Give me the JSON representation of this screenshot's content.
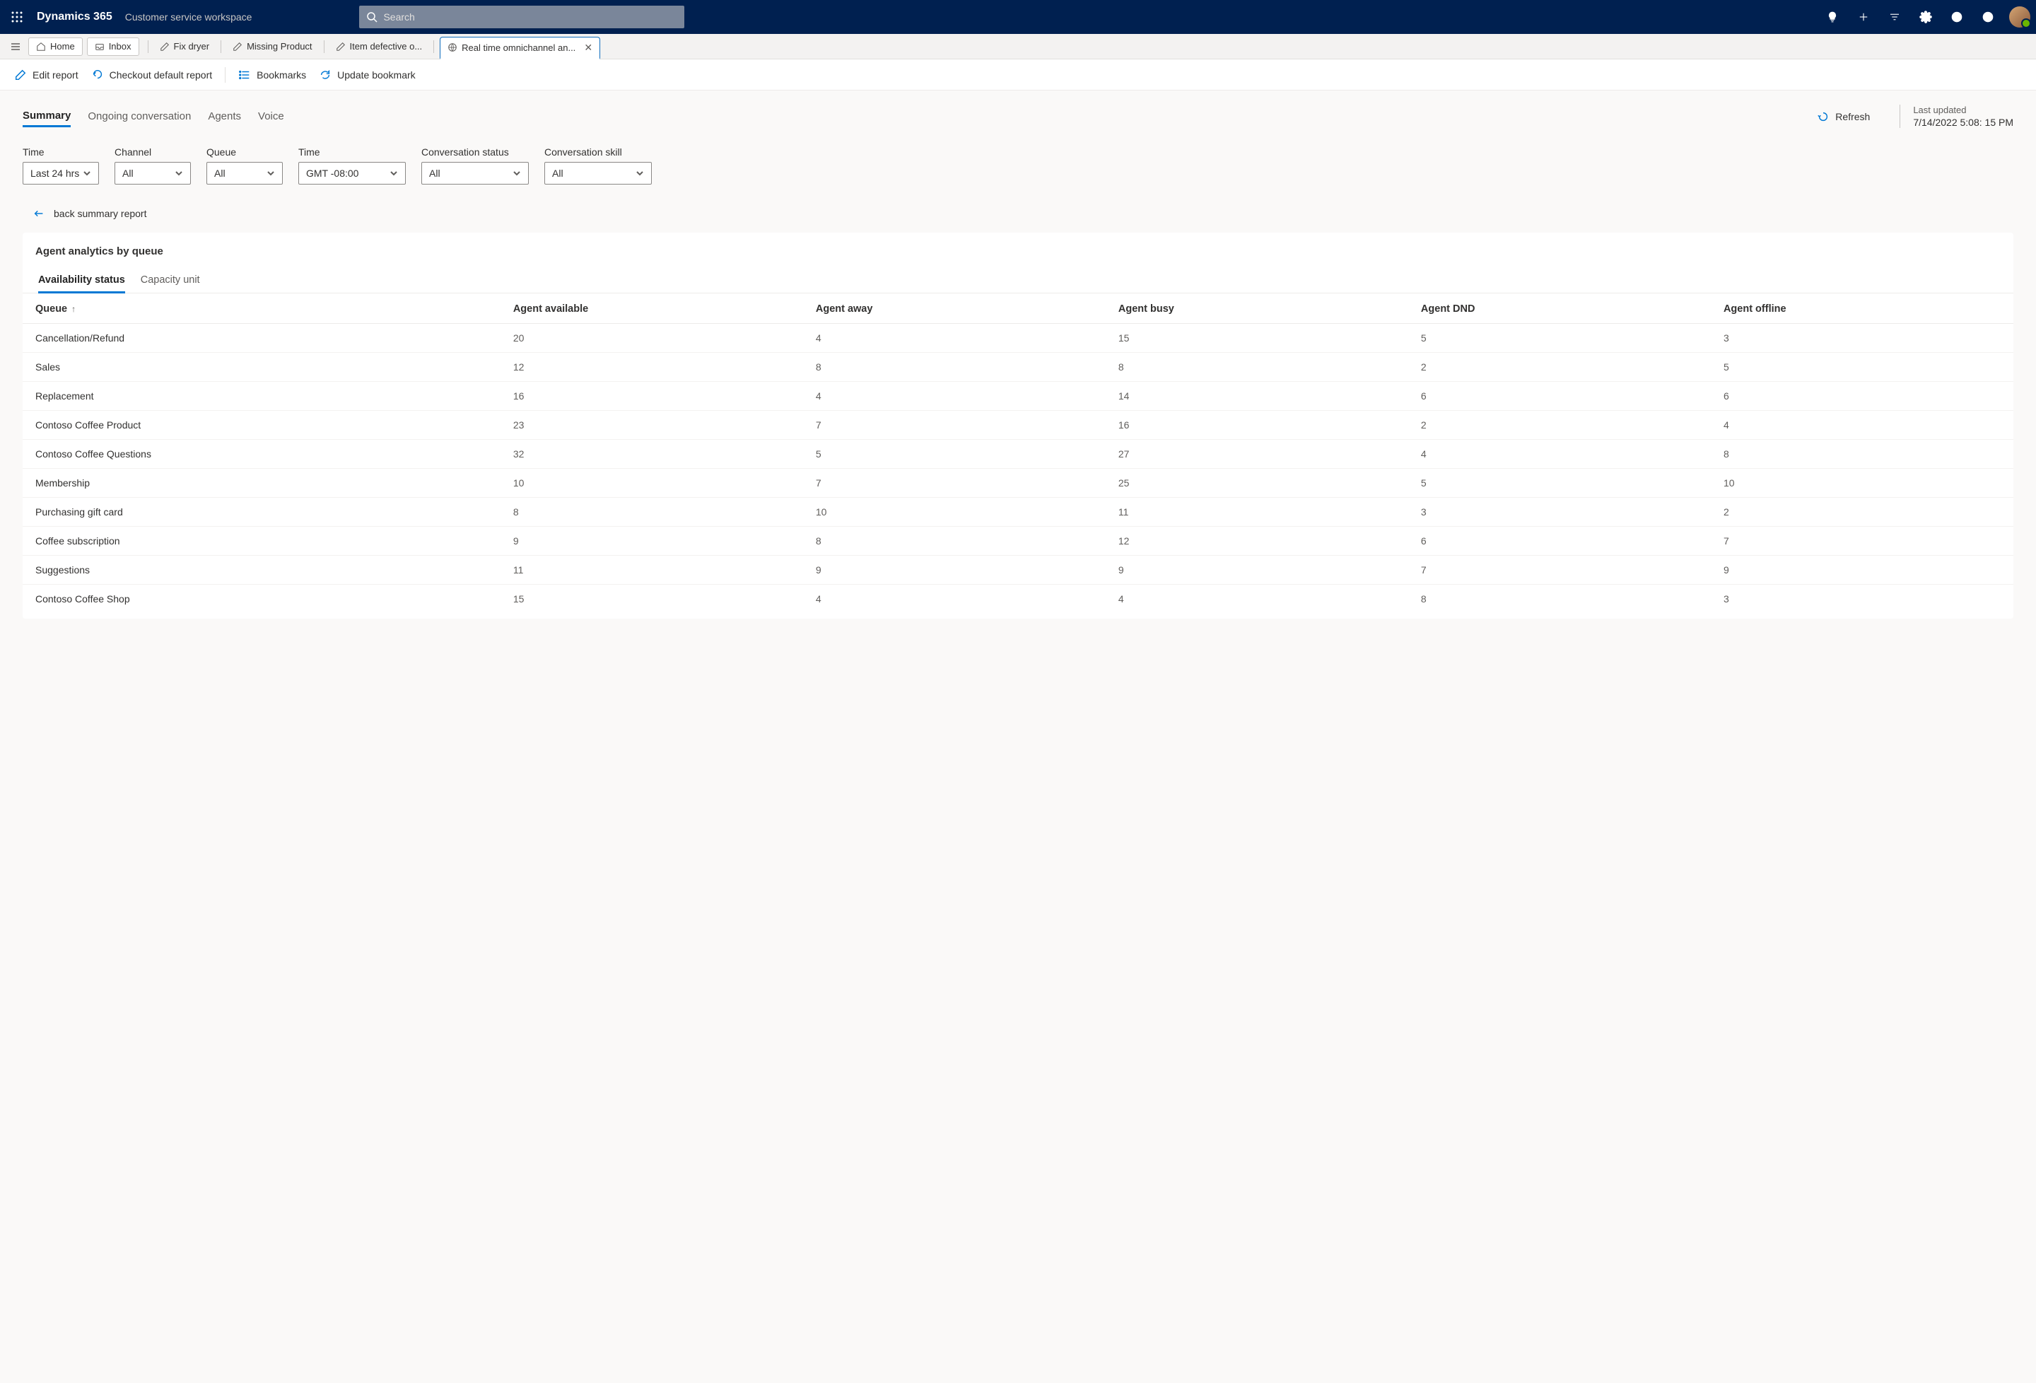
{
  "topbar": {
    "app": "Dynamics 365",
    "sub": "Customer service workspace",
    "search_placeholder": "Search"
  },
  "tabs": {
    "home": "Home",
    "inbox": "Inbox",
    "items": [
      "Fix dryer",
      "Missing Product",
      "Item defective o...",
      "Real time omnichannel an..."
    ]
  },
  "commands": {
    "edit": "Edit report",
    "checkout": "Checkout default report",
    "bookmarks": "Bookmarks",
    "update_bm": "Update bookmark"
  },
  "page_tabs": [
    "Summary",
    "Ongoing conversation",
    "Agents",
    "Voice"
  ],
  "refresh_label": "Refresh",
  "last_updated": {
    "label": "Last updated",
    "ts": "7/14/2022 5:08: 15 PM"
  },
  "filters": [
    {
      "label": "Time",
      "value": "Last 24 hrs"
    },
    {
      "label": "Channel",
      "value": "All"
    },
    {
      "label": "Queue",
      "value": "All"
    },
    {
      "label": "Time",
      "value": "GMT -08:00",
      "wide": true
    },
    {
      "label": "Conversation status",
      "value": "All",
      "wide": true
    },
    {
      "label": "Conversation skill",
      "value": "All",
      "wide": true
    }
  ],
  "back_label": "back summary report",
  "card": {
    "title": "Agent analytics by queue",
    "sub_tabs": [
      "Availability status",
      "Capacity unit"
    ],
    "columns": [
      "Queue",
      "Agent available",
      "Agent away",
      "Agent busy",
      "Agent DND",
      "Agent offline"
    ],
    "rows": [
      {
        "queue": "Cancellation/Refund",
        "available": "20",
        "away": "4",
        "busy": "15",
        "dnd": "5",
        "offline": "3"
      },
      {
        "queue": "Sales",
        "available": "12",
        "away": "8",
        "busy": "8",
        "dnd": "2",
        "offline": "5"
      },
      {
        "queue": "Replacement",
        "available": "16",
        "away": "4",
        "busy": "14",
        "dnd": "6",
        "offline": "6"
      },
      {
        "queue": "Contoso Coffee Product",
        "available": "23",
        "away": "7",
        "busy": "16",
        "dnd": "2",
        "offline": "4"
      },
      {
        "queue": "Contoso Coffee Questions",
        "available": "32",
        "away": "5",
        "busy": "27",
        "dnd": "4",
        "offline": "8"
      },
      {
        "queue": "Membership",
        "available": "10",
        "away": "7",
        "busy": "25",
        "dnd": "5",
        "offline": "10"
      },
      {
        "queue": "Purchasing gift card",
        "available": "8",
        "away": "10",
        "busy": "11",
        "dnd": "3",
        "offline": "2"
      },
      {
        "queue": "Coffee subscription",
        "available": "9",
        "away": "8",
        "busy": "12",
        "dnd": "6",
        "offline": "7"
      },
      {
        "queue": "Suggestions",
        "available": "11",
        "away": "9",
        "busy": "9",
        "dnd": "7",
        "offline": "9"
      },
      {
        "queue": "Contoso Coffee Shop",
        "available": "15",
        "away": "4",
        "busy": "4",
        "dnd": "8",
        "offline": "3"
      }
    ]
  }
}
